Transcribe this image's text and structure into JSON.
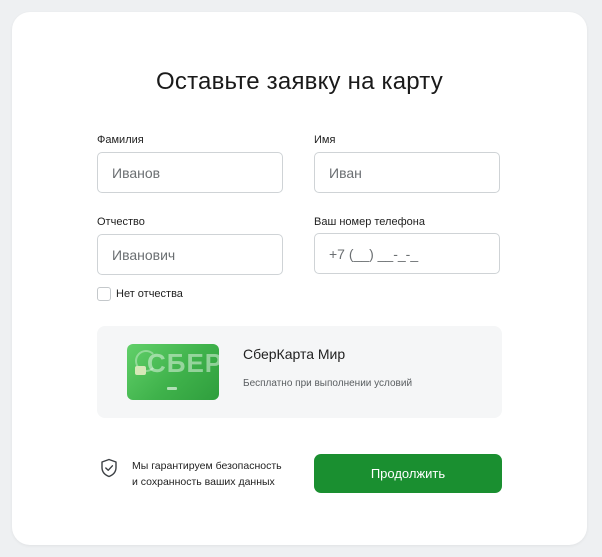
{
  "form": {
    "title": "Оставьте заявку на карту",
    "last_name": {
      "label": "Фамилия",
      "placeholder": "Иванов"
    },
    "first_name": {
      "label": "Имя",
      "placeholder": "Иван"
    },
    "patronymic": {
      "label": "Отчество",
      "placeholder": "Иванович"
    },
    "phone": {
      "label": "Ваш номер телефона",
      "placeholder": "+7 (__) __-_-_"
    },
    "no_patronymic": {
      "label": "Нет отчества",
      "checked": false
    }
  },
  "product": {
    "card_logo": "СБЕР",
    "name": "СберКарта Мир",
    "description": "Бесплатно при выполнении условий",
    "card_color": "#3fb24b"
  },
  "footer": {
    "guarantee_line1": "Мы гарантируем безопасность",
    "guarantee_line2": "и сохранность ваших данных",
    "guarantee_icon": "shield-check-icon",
    "continue_label": "Продолжить",
    "accent_color": "#1a8f30"
  }
}
